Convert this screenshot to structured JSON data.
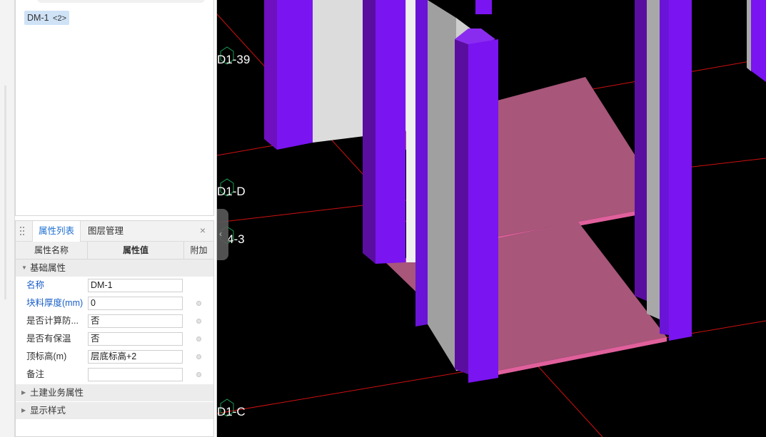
{
  "component_list": {
    "tag_name": "DM-1",
    "tag_count": "<2>"
  },
  "properties_panel": {
    "tabs": [
      "属性列表",
      "图层管理"
    ],
    "columns": {
      "name": "属性名称",
      "value": "属性值",
      "extra": "附加"
    },
    "groups": {
      "basic": "基础属性",
      "civil": "土建业务属性",
      "display": "显示样式"
    },
    "rows": [
      {
        "name": "名称",
        "value": "DM-1"
      },
      {
        "name": "块料厚度(mm)",
        "value": "0"
      },
      {
        "name": "是否计算防...",
        "value": "否"
      },
      {
        "name": "是否有保温",
        "value": "否"
      },
      {
        "name": "顶标高(m)",
        "value": "层底标高+2"
      },
      {
        "name": "备注",
        "value": ""
      }
    ]
  },
  "viewport": {
    "axis_labels": [
      "D1-39",
      "D1-D",
      "4-3",
      "D1-C"
    ],
    "colors": {
      "background": "#000000",
      "column": "#7a14f0",
      "wall": "#a8a8a8",
      "slab": "#a8567a",
      "grid_line": "#d01010"
    }
  }
}
